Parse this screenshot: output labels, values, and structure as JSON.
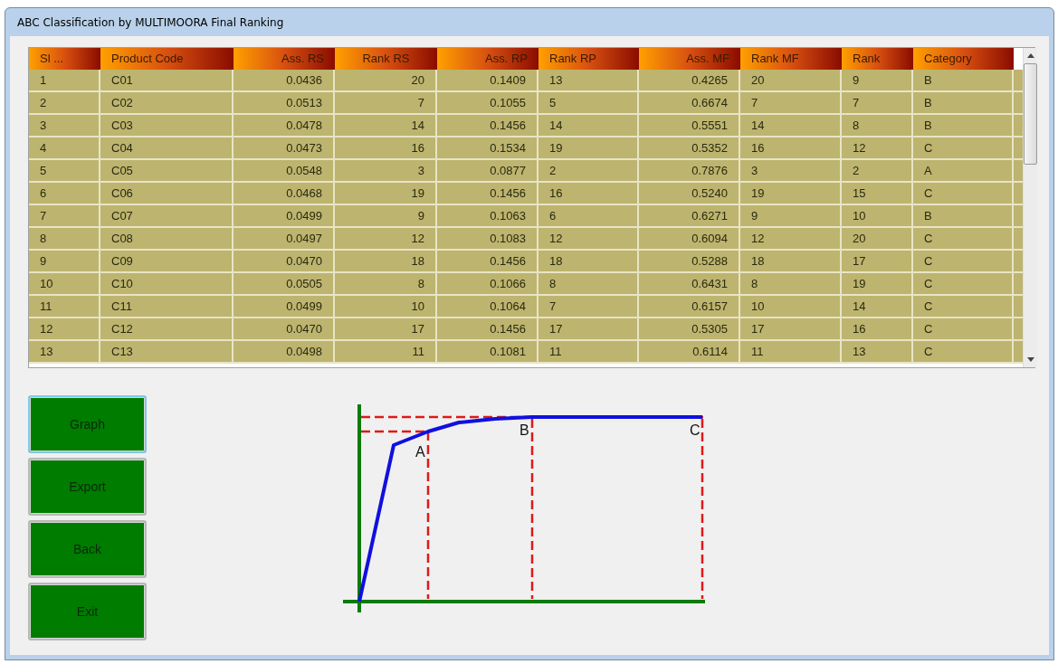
{
  "window": {
    "title": "ABC Classification by MULTIMOORA Final Ranking"
  },
  "table": {
    "columns": [
      "Sl ...",
      "Product Code",
      "Ass. RS",
      "Rank RS",
      "Ass. RP",
      "Rank RP",
      "Ass. MF",
      "Rank MF",
      "Rank",
      "Category"
    ],
    "rows": [
      [
        "1",
        "C01",
        "0.0436",
        "20",
        "0.1409",
        "13",
        "0.4265",
        "20",
        "9",
        "B"
      ],
      [
        "2",
        "C02",
        "0.0513",
        "7",
        "0.1055",
        "5",
        "0.6674",
        "7",
        "7",
        "B"
      ],
      [
        "3",
        "C03",
        "0.0478",
        "14",
        "0.1456",
        "14",
        "0.5551",
        "14",
        "8",
        "B"
      ],
      [
        "4",
        "C04",
        "0.0473",
        "16",
        "0.1534",
        "19",
        "0.5352",
        "16",
        "12",
        "C"
      ],
      [
        "5",
        "C05",
        "0.0548",
        "3",
        "0.0877",
        "2",
        "0.7876",
        "3",
        "2",
        "A"
      ],
      [
        "6",
        "C06",
        "0.0468",
        "19",
        "0.1456",
        "16",
        "0.5240",
        "19",
        "15",
        "C"
      ],
      [
        "7",
        "C07",
        "0.0499",
        "9",
        "0.1063",
        "6",
        "0.6271",
        "9",
        "10",
        "B"
      ],
      [
        "8",
        "C08",
        "0.0497",
        "12",
        "0.1083",
        "12",
        "0.6094",
        "12",
        "20",
        "C"
      ],
      [
        "9",
        "C09",
        "0.0470",
        "18",
        "0.1456",
        "18",
        "0.5288",
        "18",
        "17",
        "C"
      ],
      [
        "10",
        "C10",
        "0.0505",
        "8",
        "0.1066",
        "8",
        "0.6431",
        "8",
        "19",
        "C"
      ],
      [
        "11",
        "C11",
        "0.0499",
        "10",
        "0.1064",
        "7",
        "0.6157",
        "10",
        "14",
        "C"
      ],
      [
        "12",
        "C12",
        "0.0470",
        "17",
        "0.1456",
        "17",
        "0.5305",
        "17",
        "16",
        "C"
      ],
      [
        "13",
        "C13",
        "0.0498",
        "11",
        "0.1081",
        "11",
        "0.6114",
        "11",
        "13",
        "C"
      ]
    ]
  },
  "buttons": [
    {
      "label": "Graph",
      "focused": true
    },
    {
      "label": "Export",
      "focused": false
    },
    {
      "label": "Back",
      "focused": false
    },
    {
      "label": "Exit",
      "focused": false
    }
  ],
  "graph": {
    "labels": [
      "A",
      "B",
      "C"
    ]
  }
}
